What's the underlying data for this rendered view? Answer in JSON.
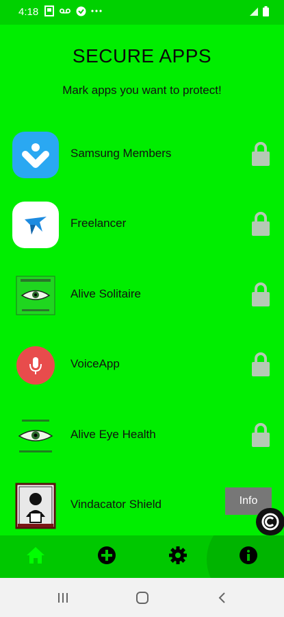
{
  "status_bar": {
    "time": "4:18",
    "icons": [
      "photo-icon",
      "voicemail-icon",
      "vpn-icon",
      "more-notifications-icon"
    ],
    "right_icons": [
      "signal-icon",
      "battery-icon"
    ],
    "color": "#00d100"
  },
  "header": {
    "title": "SECURE APPS",
    "subtitle": "Mark apps you want to protect!"
  },
  "apps": [
    {
      "name": "Samsung Members",
      "icon": "samsung-members-icon",
      "locked": false
    },
    {
      "name": "Freelancer",
      "icon": "freelancer-icon",
      "locked": false
    },
    {
      "name": "Alive Solitaire",
      "icon": "alive-solitaire-icon",
      "locked": false
    },
    {
      "name": "VoiceApp",
      "icon": "voiceapp-icon",
      "locked": false
    },
    {
      "name": "Alive Eye Health",
      "icon": "alive-eye-health-icon",
      "locked": false
    },
    {
      "name": "Vindacator Shield",
      "icon": "vindacator-shield-icon",
      "locked": false
    }
  ],
  "info_toast": {
    "label": "Info"
  },
  "bottom_nav": {
    "items": [
      {
        "name": "home",
        "icon": "home-icon",
        "active": true
      },
      {
        "name": "add",
        "icon": "add-icon",
        "active": false
      },
      {
        "name": "settings",
        "icon": "gear-icon",
        "active": false
      },
      {
        "name": "info",
        "icon": "info-icon",
        "active": false
      }
    ]
  },
  "system_nav": {
    "buttons": [
      "recent-apps-icon",
      "home-circle-icon",
      "back-icon"
    ]
  },
  "colors": {
    "background": "#00ee00",
    "nav_bar": "#00c800",
    "active_nav": "#00ff00",
    "lock": "#b5c9b5"
  }
}
